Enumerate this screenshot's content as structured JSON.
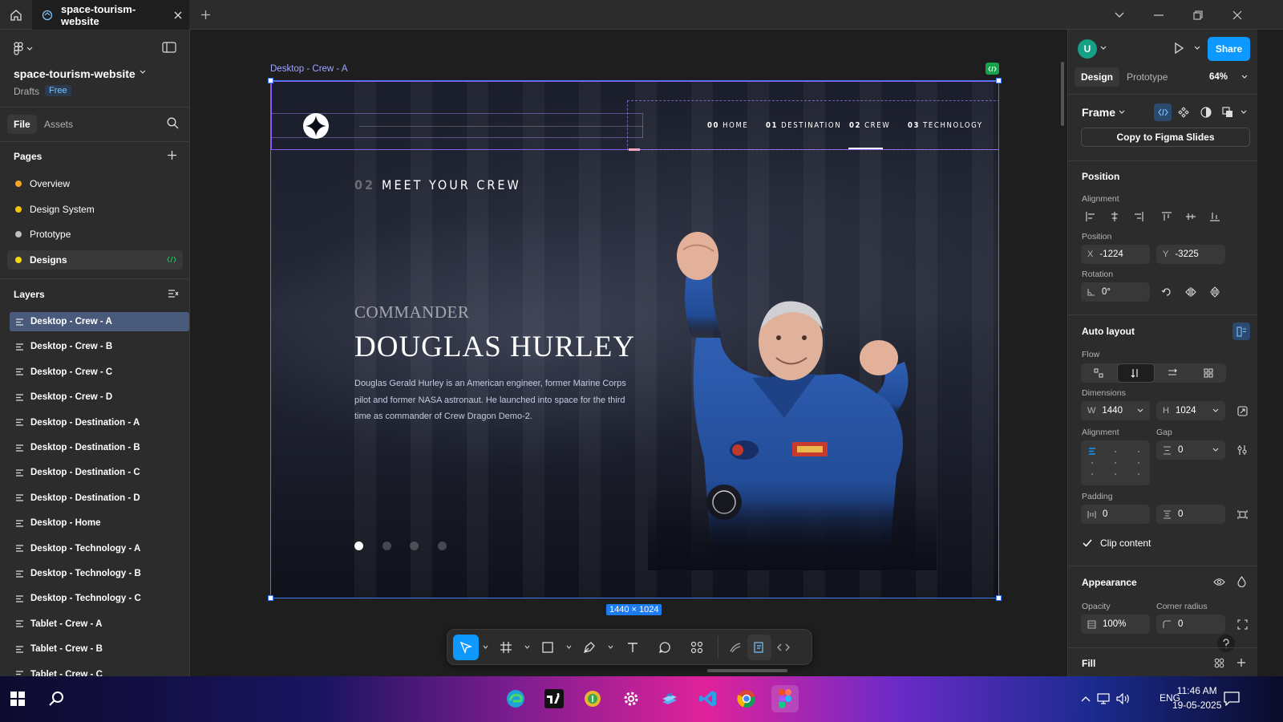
{
  "topbar": {
    "tab_title": "space-tourism-website"
  },
  "left": {
    "project_name": "space-tourism-website",
    "drafts_label": "Drafts",
    "plan_badge": "Free",
    "file_tab": "File",
    "assets_tab": "Assets",
    "pages_title": "Pages",
    "pages": [
      {
        "label": "Overview",
        "color": "#f5a623"
      },
      {
        "label": "Design System",
        "color": "#f5c400"
      },
      {
        "label": "Prototype",
        "color": "#bfbfbf"
      },
      {
        "label": "Designs",
        "color": "#f5d90a"
      }
    ],
    "layers_title": "Layers",
    "layers": [
      "Desktop - Crew - A",
      "Desktop - Crew - B",
      "Desktop - Crew - C",
      "Desktop - Crew - D",
      "Desktop - Destination - A",
      "Desktop - Destination - B",
      "Desktop - Destination - C",
      "Desktop - Destination - D",
      "Desktop - Home",
      "Desktop - Technology - A",
      "Desktop - Technology - B",
      "Desktop - Technology - C",
      "Tablet - Crew - A",
      "Tablet - Crew - B",
      "Tablet - Crew - C"
    ]
  },
  "canvas": {
    "frame_label": "Desktop - Crew - A",
    "size_badge": "1440 × 1024",
    "nav": [
      {
        "num": "00",
        "label": "HOME"
      },
      {
        "num": "01",
        "label": "DESTINATION"
      },
      {
        "num": "02",
        "label": "CREW"
      },
      {
        "num": "03",
        "label": "TECHNOLOGY"
      }
    ],
    "heading_num": "02",
    "heading": "MEET YOUR CREW",
    "role": "COMMANDER",
    "name": "DOUGLAS HURLEY",
    "bio": "Douglas Gerald Hurley is an American engineer, former Marine Corps pilot and former NASA astronaut. He launched into space for the third time as commander of Crew Dragon Demo-2.",
    "active_dot": 0
  },
  "right": {
    "avatar_initial": "U",
    "share_label": "Share",
    "design_tab": "Design",
    "prototype_tab": "Prototype",
    "zoom": "64%",
    "frame_dropdown": "Frame",
    "copy_slides": "Copy to Figma Slides",
    "position_title": "Position",
    "alignment_label": "Alignment",
    "position_label": "Position",
    "x_key": "X",
    "x_value": "-1224",
    "y_key": "Y",
    "y_value": "-3225",
    "rotation_label": "Rotation",
    "rotation_value": "0°",
    "autolayout_title": "Auto layout",
    "flow_label": "Flow",
    "dimensions_label": "Dimensions",
    "w_key": "W",
    "w_value": "1440",
    "h_key": "H",
    "h_value": "1024",
    "al_alignment_label": "Alignment",
    "gap_label": "Gap",
    "gap_value": "0",
    "padding_label": "Padding",
    "padding_h": "0",
    "padding_v": "0",
    "clip_label": "Clip content",
    "appearance_title": "Appearance",
    "opacity_label": "Opacity",
    "opacity_value": "100%",
    "corner_label": "Corner radius",
    "corner_value": "0",
    "fill_title": "Fill"
  },
  "taskbar": {
    "lang": "ENG",
    "time": "11:46 AM",
    "date": "19-05-2025"
  }
}
